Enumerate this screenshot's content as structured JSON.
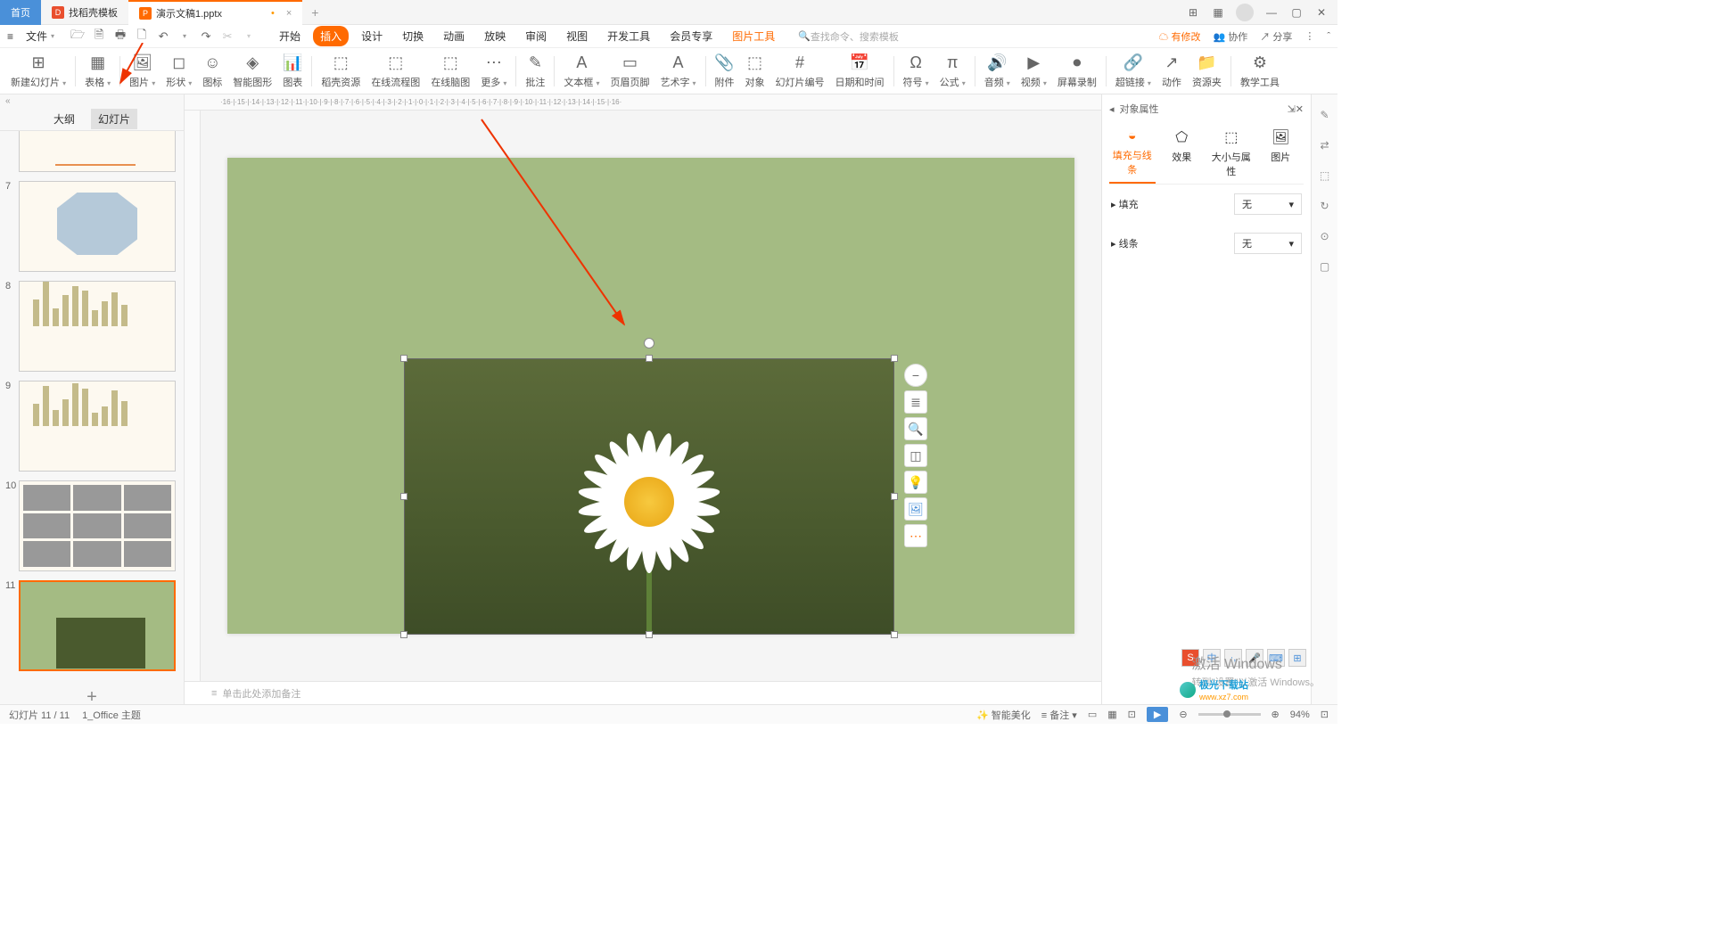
{
  "tabs": {
    "home": "首页",
    "template_tab": "找稻壳模板",
    "current": "演示文稿1.pptx"
  },
  "menu": {
    "file": "文件",
    "tabs": [
      "开始",
      "插入",
      "设计",
      "切换",
      "动画",
      "放映",
      "审阅",
      "视图",
      "开发工具",
      "会员专享",
      "图片工具"
    ],
    "search_placeholder": "查找命令、搜索模板",
    "unsaved": "有修改",
    "coop": "协作",
    "share": "分享"
  },
  "ribbon": [
    {
      "label": "新建幻灯片",
      "icon": "⊞"
    },
    {
      "label": "表格",
      "icon": "▦"
    },
    {
      "label": "图片",
      "icon": "🖼"
    },
    {
      "label": "形状",
      "icon": "◻"
    },
    {
      "label": "图标",
      "icon": "☺"
    },
    {
      "label": "智能图形",
      "icon": "◈"
    },
    {
      "label": "图表",
      "icon": "📊"
    },
    {
      "label": "稻壳资源",
      "icon": "⬚"
    },
    {
      "label": "在线流程图",
      "icon": "⬚"
    },
    {
      "label": "在线脑图",
      "icon": "⬚"
    },
    {
      "label": "更多",
      "icon": "⋯"
    },
    {
      "label": "批注",
      "icon": "✎"
    },
    {
      "label": "文本框",
      "icon": "A"
    },
    {
      "label": "页眉页脚",
      "icon": "▭"
    },
    {
      "label": "艺术字",
      "icon": "A"
    },
    {
      "label": "附件",
      "icon": "📎"
    },
    {
      "label": "对象",
      "icon": "⬚"
    },
    {
      "label": "幻灯片编号",
      "icon": "#"
    },
    {
      "label": "日期和时间",
      "icon": "📅"
    },
    {
      "label": "符号",
      "icon": "Ω"
    },
    {
      "label": "公式",
      "icon": "π"
    },
    {
      "label": "音频",
      "icon": "🔊"
    },
    {
      "label": "视频",
      "icon": "▶"
    },
    {
      "label": "屏幕录制",
      "icon": "⏺"
    },
    {
      "label": "超链接",
      "icon": "🔗"
    },
    {
      "label": "动作",
      "icon": "↗"
    },
    {
      "label": "资源夹",
      "icon": "📁"
    },
    {
      "label": "教学工具",
      "icon": "⚙"
    }
  ],
  "sidebar": {
    "tabs": {
      "outline": "大纲",
      "slides": "幻灯片"
    },
    "collapse": "«"
  },
  "thumbnails": [
    7,
    8,
    9,
    10,
    11
  ],
  "right_panel": {
    "title": "对象属性",
    "tabs": {
      "fill": "填充与线条",
      "effect": "效果",
      "size": "大小与属性",
      "picture": "图片"
    },
    "fill_label": "填充",
    "line_label": "线条",
    "option_none": "无"
  },
  "notes_placeholder": "单击此处添加备注",
  "status": {
    "slide": "幻灯片 11 / 11",
    "theme": "1_Office 主题",
    "beauty": "智能美化",
    "notes": "备注",
    "zoom": "94%"
  },
  "watermark": {
    "line1": "激活 Windows",
    "line2": "转到\"设置\"以激活 Windows。"
  },
  "logo": "极光下载站",
  "logo_url": "www.xz7.com",
  "ime": {
    "s": "S",
    "mid": "中"
  }
}
